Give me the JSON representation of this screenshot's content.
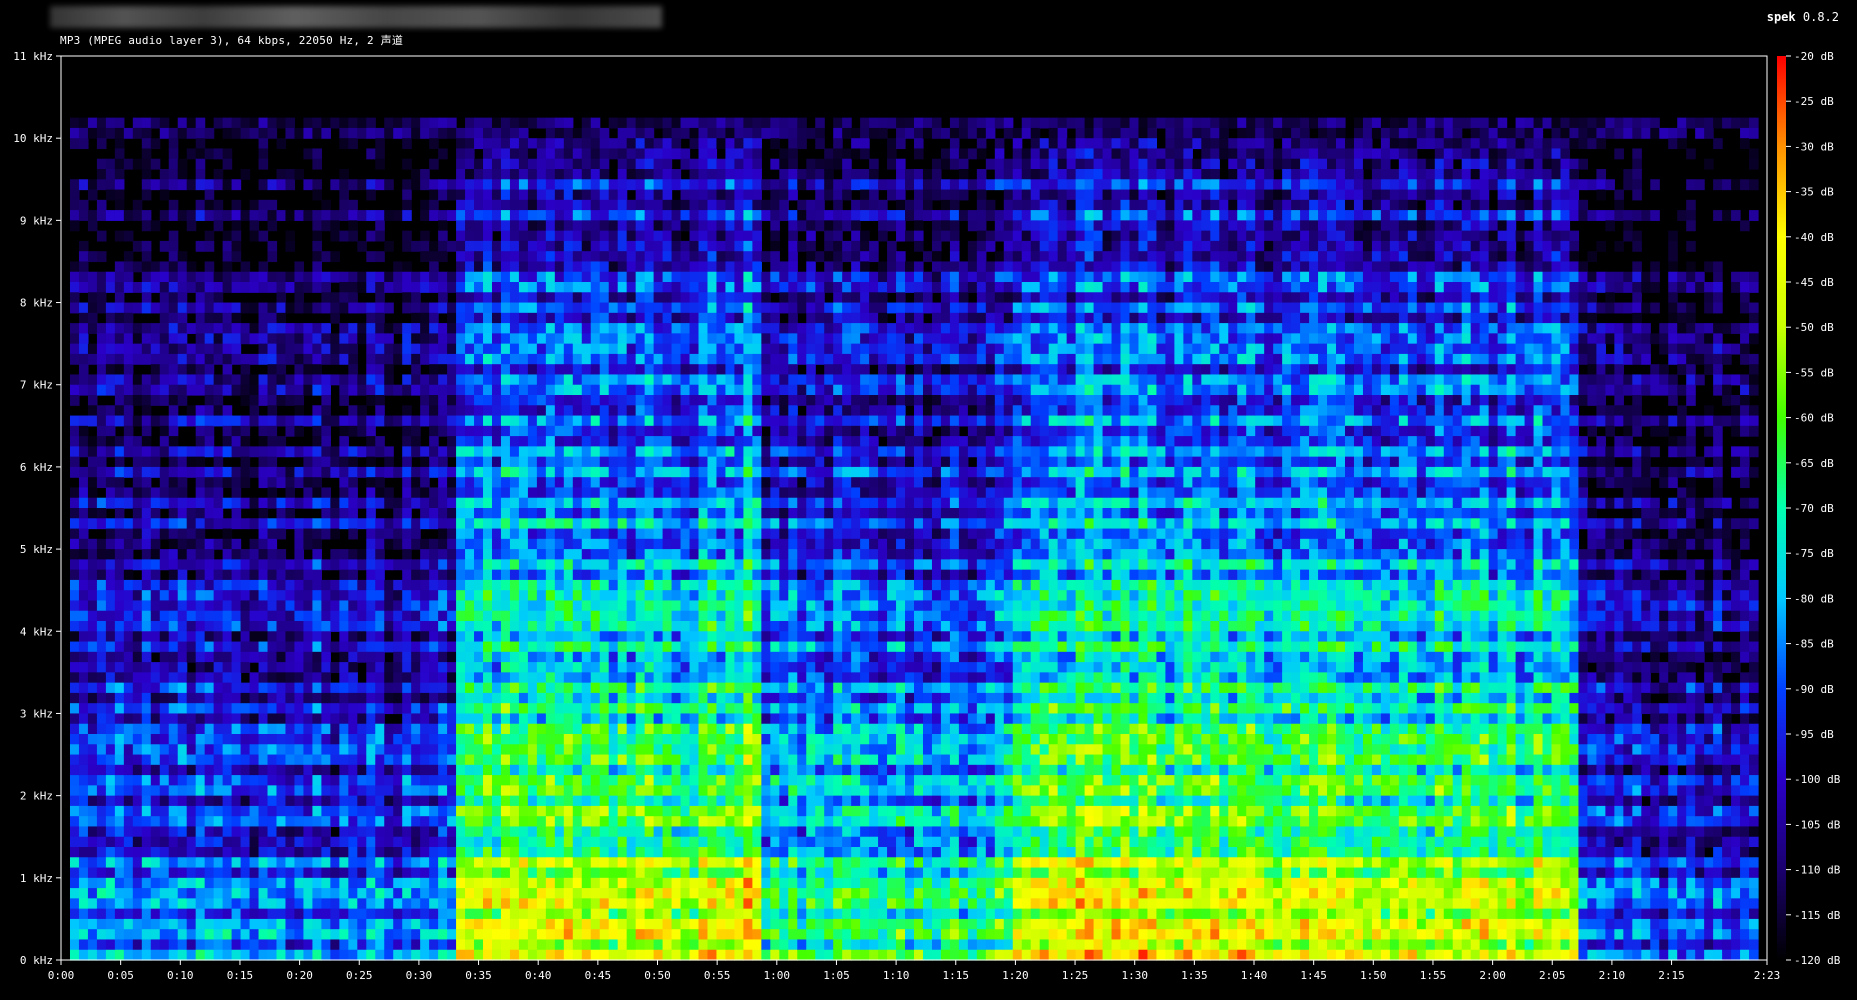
{
  "header": {
    "filename": "",
    "info": "MP3 (MPEG audio layer 3), 64 kbps, 22050 Hz, 2 声道",
    "app_name": "spek",
    "app_version": "0.8.2"
  },
  "chart_data": {
    "type": "heatmap",
    "title": "",
    "xlabel": "",
    "ylabel": "",
    "y_ticks": [
      "0 kHz",
      "1 kHz",
      "2 kHz",
      "3 kHz",
      "4 kHz",
      "5 kHz",
      "6 kHz",
      "7 kHz",
      "8 kHz",
      "9 kHz",
      "10 kHz",
      "11 kHz"
    ],
    "y_range_khz": [
      0,
      11
    ],
    "x_ticks": [
      "0:00",
      "0:05",
      "0:10",
      "0:15",
      "0:20",
      "0:25",
      "0:30",
      "0:35",
      "0:40",
      "0:45",
      "0:50",
      "0:55",
      "1:00",
      "1:05",
      "1:10",
      "1:15",
      "1:20",
      "1:25",
      "1:30",
      "1:35",
      "1:40",
      "1:45",
      "1:50",
      "1:55",
      "2:00",
      "2:05",
      "2:10",
      "2:15",
      "2:23"
    ],
    "x_range_seconds": [
      0,
      143
    ],
    "colorbar_ticks": [
      "-20 dB",
      "-25 dB",
      "-30 dB",
      "-35 dB",
      "-40 dB",
      "-45 dB",
      "-50 dB",
      "-55 dB",
      "-60 dB",
      "-65 dB",
      "-70 dB",
      "-75 dB",
      "-80 dB",
      "-85 dB",
      "-90 dB",
      "-95 dB",
      "-100 dB",
      "-105 dB",
      "-110 dB",
      "-115 dB",
      "-120 dB"
    ],
    "colorbar_range_db": [
      -120,
      -20
    ],
    "colormap": [
      "#000000",
      "#1a006e",
      "#2a00c8",
      "#0040ff",
      "#00c8ff",
      "#00ffb0",
      "#40ff00",
      "#c8ff00",
      "#ffff00",
      "#ff9000",
      "#ff0000"
    ],
    "cutoff_khz": 10,
    "segments": [
      {
        "start_s": 0,
        "end_s": 1,
        "intensity": 0.05
      },
      {
        "start_s": 1,
        "end_s": 33,
        "intensity": 0.35
      },
      {
        "start_s": 33,
        "end_s": 57,
        "intensity": 0.62
      },
      {
        "start_s": 57,
        "end_s": 59,
        "intensity": 0.7
      },
      {
        "start_s": 59,
        "end_s": 80,
        "intensity": 0.48
      },
      {
        "start_s": 80,
        "end_s": 101,
        "intensity": 0.66
      },
      {
        "start_s": 101,
        "end_s": 127,
        "intensity": 0.62
      },
      {
        "start_s": 127,
        "end_s": 142,
        "intensity": 0.32
      },
      {
        "start_s": 142,
        "end_s": 143,
        "intensity": 0.05
      }
    ]
  }
}
